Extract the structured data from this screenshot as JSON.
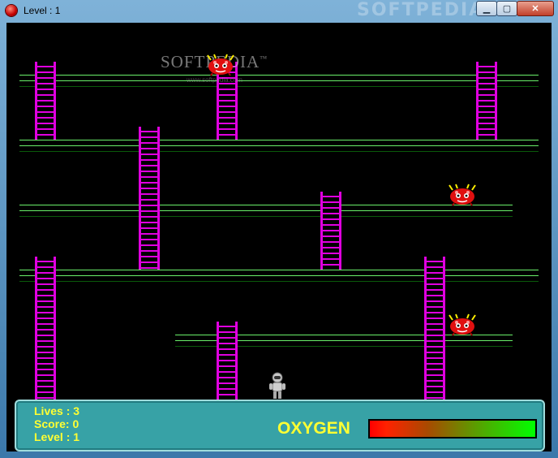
{
  "window": {
    "title": "Level : 1",
    "watermark_title": "SOFTPEDIA",
    "controls": {
      "minimize": "▁",
      "maximize": "▢",
      "close": "✕"
    }
  },
  "game": {
    "watermark": "SOFTPEDIA",
    "watermark_tm": "™",
    "watermark_url": "www.softpedia.com",
    "colors": {
      "brick": "#1cb51c",
      "ladder": "#e000e0",
      "enemy": "#e01010",
      "hud_text": "#ffff33",
      "hud_bg": "#37a2a6"
    }
  },
  "hud": {
    "lives": "Lives : 3",
    "score": "Score: 0",
    "level": "Level : 1",
    "oxygen_label": "OXYGEN",
    "oxygen_level": 1.0
  },
  "icons": {
    "app": "red-orb-icon",
    "enemy": "red-alien-icon",
    "player": "astronaut-icon"
  }
}
